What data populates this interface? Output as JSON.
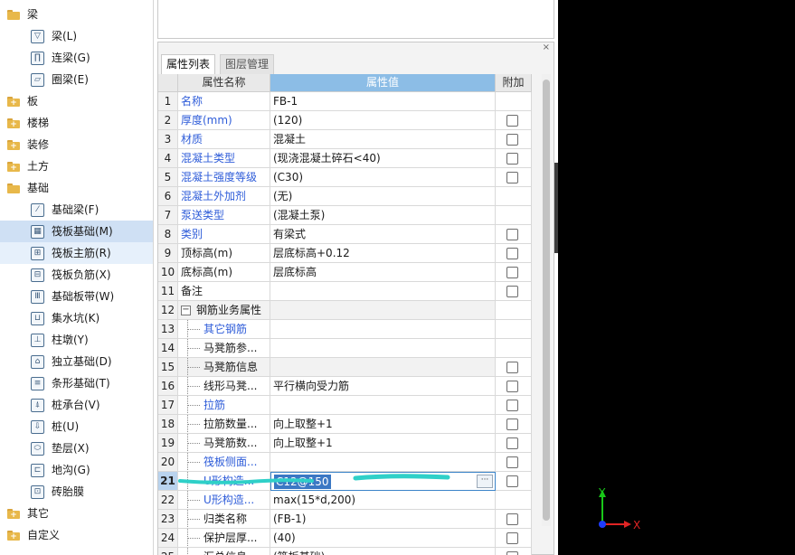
{
  "tree": {
    "top_items": {
      "liang": "梁",
      "ban": "板",
      "louti": "楼梯",
      "zhuangxiu": "装修",
      "tufang": "土方",
      "jichu": "基础",
      "qita": "其它",
      "zidingyi": "自定义"
    },
    "liang_children": [
      "梁(L)",
      "连梁(G)",
      "圈梁(E)"
    ],
    "jichu_children": [
      "基础梁(F)",
      "筏板基础(M)",
      "筏板主筋(R)",
      "筏板负筋(X)",
      "基础板带(W)",
      "集水坑(K)",
      "柱墩(Y)",
      "独立基础(D)",
      "条形基础(T)",
      "桩承台(V)",
      "桩(U)",
      "垫层(X)",
      "地沟(G)",
      "砖胎膜"
    ],
    "selected": "筏板基础(M)"
  },
  "panel": {
    "close_label": "×",
    "tabs": [
      "属性列表",
      "图层管理"
    ],
    "headers": {
      "name": "属性名称",
      "value": "属性值",
      "add": "附加"
    },
    "group_toggle": "−",
    "ellipsis": "···",
    "rows": [
      {
        "num": "1",
        "name": "名称",
        "value": "FB-1"
      },
      {
        "num": "2",
        "name": "厚度(mm)",
        "value": "(120)"
      },
      {
        "num": "3",
        "name": "材质",
        "value": "混凝土"
      },
      {
        "num": "4",
        "name": "混凝土类型",
        "value": "(现浇混凝土碎石<40)"
      },
      {
        "num": "5",
        "name": "混凝土强度等级",
        "value": "(C30)"
      },
      {
        "num": "6",
        "name": "混凝土外加剂",
        "value": "(无)"
      },
      {
        "num": "7",
        "name": "泵送类型",
        "value": "(混凝土泵)"
      },
      {
        "num": "8",
        "name": "类别",
        "value": "有梁式"
      },
      {
        "num": "9",
        "name": "顶标高(m)",
        "value": "层底标高+0.12"
      },
      {
        "num": "10",
        "name": "底标高(m)",
        "value": "层底标高"
      },
      {
        "num": "11",
        "name": "备注",
        "value": ""
      },
      {
        "num": "12",
        "name": "钢筋业务属性",
        "value": ""
      },
      {
        "num": "13",
        "name": "其它钢筋",
        "value": ""
      },
      {
        "num": "14",
        "name": "马凳筋参...",
        "value": ""
      },
      {
        "num": "15",
        "name": "马凳筋信息",
        "value": ""
      },
      {
        "num": "16",
        "name": "线形马凳...",
        "value": "平行横向受力筋"
      },
      {
        "num": "17",
        "name": "拉筋",
        "value": ""
      },
      {
        "num": "18",
        "name": "拉筋数量...",
        "value": "向上取整+1"
      },
      {
        "num": "19",
        "name": "马凳筋数...",
        "value": "向上取整+1"
      },
      {
        "num": "20",
        "name": "筏板侧面...",
        "value": ""
      },
      {
        "num": "21",
        "name": "U形构造...",
        "value": "C12@150"
      },
      {
        "num": "22",
        "name": "U形构造...",
        "value": "max(15*d,200)"
      },
      {
        "num": "23",
        "name": "归类名称",
        "value": "(FB-1)"
      },
      {
        "num": "24",
        "name": "保护层厚...",
        "value": "(40)"
      },
      {
        "num": "25",
        "name": "汇总信息",
        "value": "(筏板基础)"
      }
    ]
  },
  "axis": {
    "y_label": "Y",
    "x_label": "X"
  },
  "colors": {
    "accent_blue": "#2f5dd9",
    "header_value_bg": "#8cbde6",
    "viewport_bg": "#000000",
    "scribble": "#2fd0c8"
  }
}
